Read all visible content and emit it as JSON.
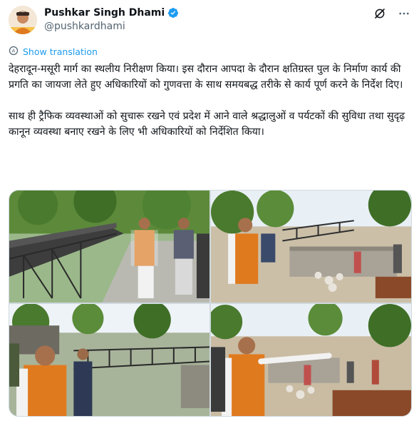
{
  "author": {
    "display_name": "Pushkar Singh Dhami",
    "handle": "@pushkardhami",
    "verified": true,
    "avatar_icon": "profile-avatar"
  },
  "actions": {
    "grok_icon": "grok-icon",
    "more_icon": "more-icon"
  },
  "translate": {
    "label": "Show translation",
    "icon": "translate-icon"
  },
  "tweet": {
    "paragraph_1": "देहरादून-मसूरी मार्ग का स्थलीय निरीक्षण किया। इस दौरान आपदा के दौरान क्षतिग्रस्त पुल के निर्माण कार्य की प्रगति का जायजा लेते हुए अधिकारियों को गुणवत्ता के साथ समयबद्ध तरीके से कार्य पूर्ण करने के निर्देश दिए।",
    "paragraph_2": "साथ ही ट्रैफिक व्यवस्थाओं को सुचारू रखने एवं प्रदेश में आने वाले श्रद्धालुओं व पर्यटकों की सुविधा तथा सुदृढ़ कानून व्यवस्था बनाए रखने के लिए भी अधिकारियों को निर्देशित किया।"
  },
  "colors": {
    "accent": "#1d9bf0",
    "text": "#0f1419",
    "secondary": "#536471",
    "border": "#cfd9de",
    "saffron_jacket": "#e07a1f"
  }
}
